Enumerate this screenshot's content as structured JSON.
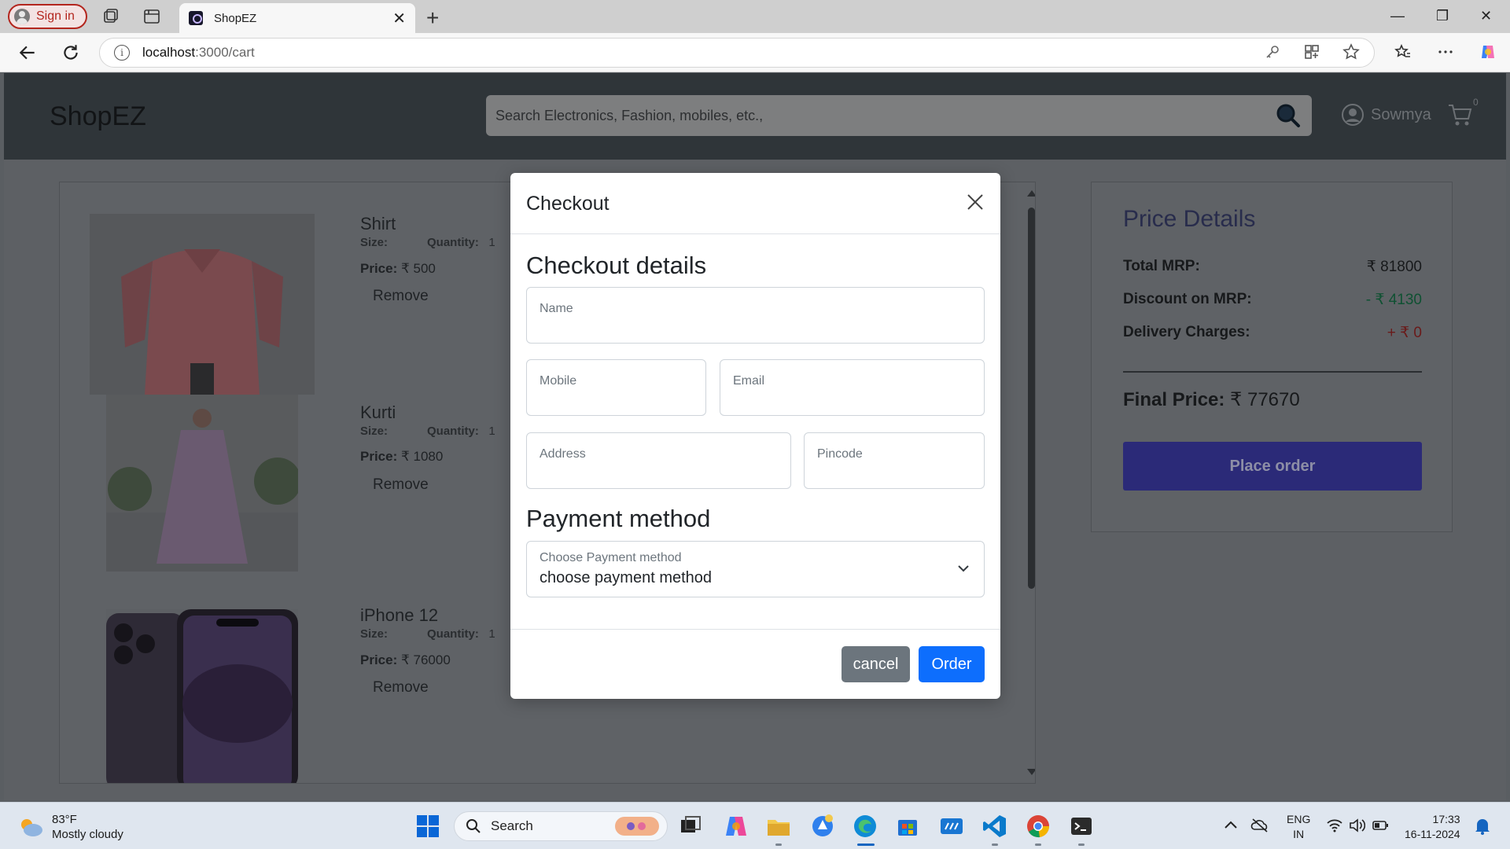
{
  "browser": {
    "signin_label": "Sign in",
    "tab_title": "ShopEZ",
    "url_host": "localhost",
    "url_path": ":3000/cart"
  },
  "header": {
    "logo": "ShopEZ",
    "search_placeholder": "Search Electronics, Fashion, mobiles, etc.,",
    "username": "Sowmya",
    "cart_count": "0"
  },
  "cart": {
    "items": [
      {
        "name": "Shirt",
        "size_label": "Size:",
        "qty_label": "Quantity:",
        "qty": "1",
        "price_label": "Price:",
        "price": "₹ 500",
        "remove": "Remove"
      },
      {
        "name": "Kurti",
        "size_label": "Size:",
        "qty_label": "Quantity:",
        "qty": "1",
        "price_label": "Price:",
        "price": "₹ 1080",
        "remove": "Remove"
      },
      {
        "name": "iPhone 12",
        "size_label": "Size:",
        "qty_label": "Quantity:",
        "qty": "1",
        "price_label": "Price:",
        "price": "₹ 76000",
        "remove": "Remove"
      }
    ]
  },
  "price_details": {
    "title": "Price Details",
    "total_mrp_label": "Total MRP:",
    "total_mrp": "₹ 81800",
    "discount_label": "Discount on MRP:",
    "discount": "- ₹ 4130",
    "delivery_label": "Delivery Charges:",
    "delivery": "+ ₹ 0",
    "final_label": "Final Price:",
    "final": "₹ 77670",
    "place_order": "Place order",
    "colors": {
      "discount": "#0f5132",
      "delivery": "#6a1a1a"
    }
  },
  "modal": {
    "title": "Checkout",
    "details_title": "Checkout details",
    "fields": {
      "name": "Name",
      "mobile": "Mobile",
      "email": "Email",
      "address": "Address",
      "pincode": "Pincode"
    },
    "payment_title": "Payment method",
    "payment_label": "Choose Payment method",
    "payment_value": "choose payment method",
    "cancel": "cancel",
    "order": "Order"
  },
  "taskbar": {
    "temp": "83°F",
    "weather": "Mostly cloudy",
    "search": "Search",
    "lang1": "ENG",
    "lang2": "IN",
    "time": "17:33",
    "date": "16-11-2024"
  }
}
